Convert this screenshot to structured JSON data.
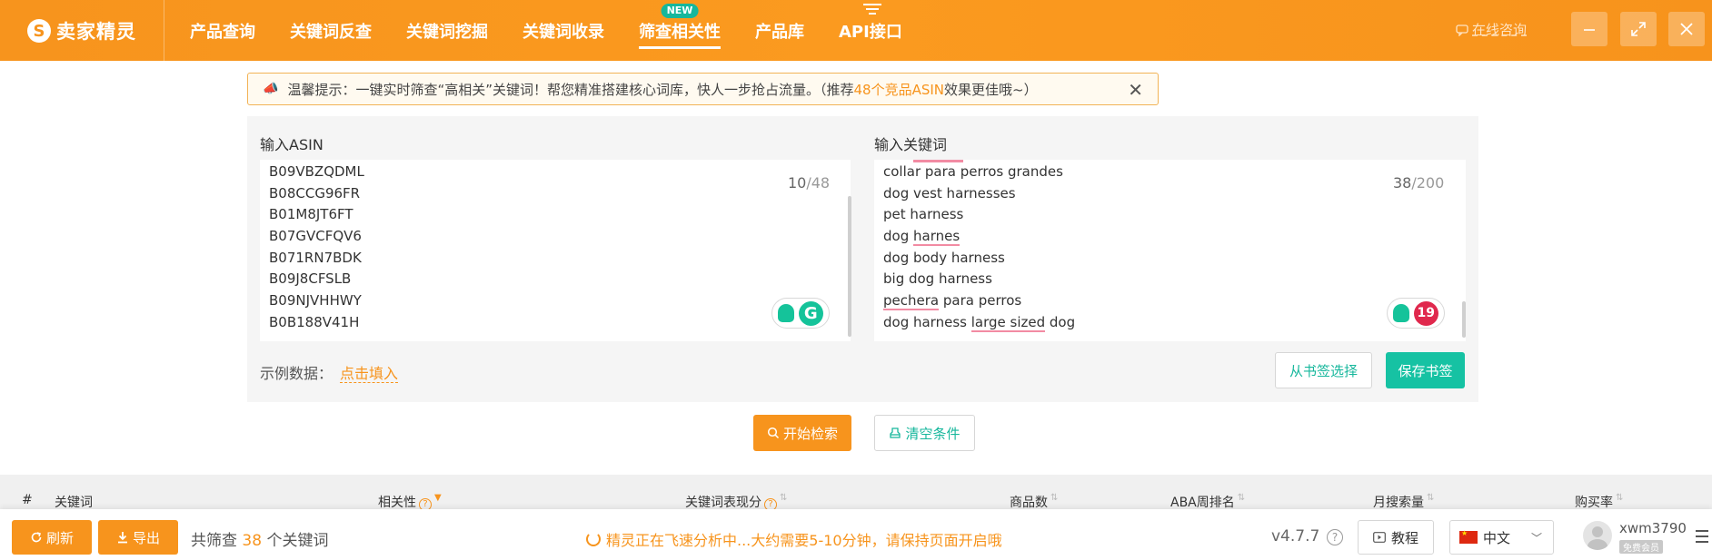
{
  "app": {
    "logo_icon": "S",
    "logo_text": "卖家精灵"
  },
  "nav": {
    "items": [
      "产品查询",
      "关键词反查",
      "关键词挖掘",
      "关键词收录",
      "筛查相关性",
      "产品库",
      "API接口"
    ],
    "active": "筛查相关性",
    "new_badge": "NEW"
  },
  "header": {
    "consult": "在线咨询",
    "minimize_icon": "minimize-icon",
    "maximize_icon": "maximize-icon",
    "close_icon": "close-icon"
  },
  "tip": {
    "prefix": "温馨提示：一键实时筛查“高相关”关键词！帮您精准搭建核心词库，快人一步抢占流量。（推荐",
    "highlight": "48个竞品ASIN",
    "suffix": "效果更佳哦~）",
    "close": "✕"
  },
  "asin_input": {
    "title": "输入ASIN",
    "lines": [
      "B09VBZQDML",
      "B08CCG96FR",
      "B01M8JT6FT",
      "B07GVCFQV6",
      "B071RN7BDK",
      "B09J8CFSLB",
      "B09NJVHHWY",
      "B0B188V41H"
    ],
    "count": "10",
    "max": "/48",
    "widget_letter": "G"
  },
  "keyword_input": {
    "title": "输入关键词",
    "lines": [
      "collar para perros grandes",
      "dog vest harnesses",
      "pet harness"
    ],
    "line_dog": "dog ",
    "line_harnes": "harnes",
    "line_body": "dog body harness",
    "line_big": "big dog harness",
    "line_pechera": "pechera",
    "line_para_perros": " para perros",
    "line_dh": "dog harness ",
    "line_large_sized": "large sized",
    "line_dog_end": " dog",
    "count": "38",
    "max": "/200",
    "issues": "19"
  },
  "example": {
    "label": "示例数据：",
    "link": "点击填入"
  },
  "bookmark": {
    "select": "从书签选择",
    "save": "保存书签"
  },
  "actions": {
    "search": "开始检索",
    "clear": "清空条件"
  },
  "table": {
    "headers": {
      "num": "#",
      "keyword": "关键词",
      "relevance": "相关性",
      "score": "关键词表现分",
      "products": "商品数",
      "aba": "ABA周排名",
      "monthly": "月搜索量",
      "purchase": "购买率"
    },
    "help": "?"
  },
  "footer": {
    "refresh": "刷新",
    "export": "导出",
    "count_prefix": "共筛查",
    "count_num": "38",
    "count_suffix": "个关键词",
    "analyzing": "精灵正在飞速分析中...大约需要5-10分钟，请保持页面开启哦",
    "version": "v4.7.7",
    "help": "?",
    "tutorial": "教程",
    "language": "中文",
    "username": "xwm3790",
    "member": "免费会员"
  }
}
